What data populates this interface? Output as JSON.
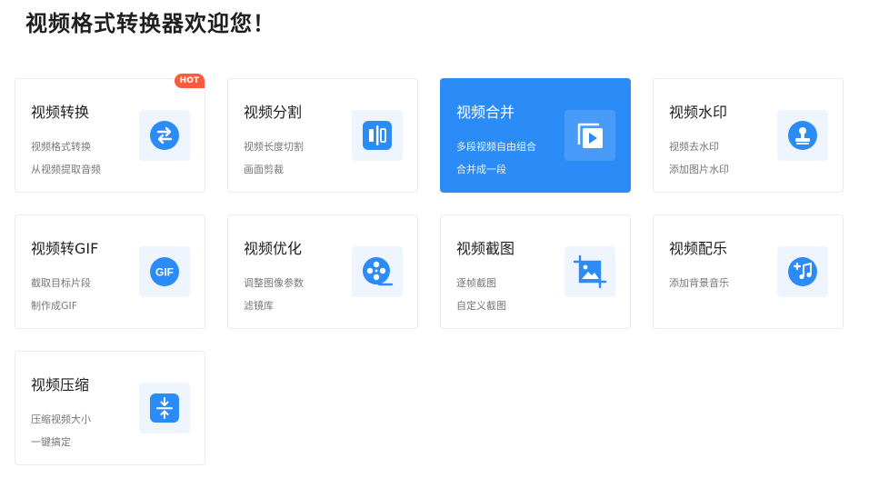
{
  "page": {
    "title": "视频格式转换器欢迎您！"
  },
  "colors": {
    "accent": "#2b8bf7",
    "hot": "#ff5a3c"
  },
  "cards": [
    {
      "title": "视频转换",
      "line1": "视频格式转换",
      "line2": "从视频提取音频",
      "icon": "swap-arrows-icon",
      "badge": "HOT"
    },
    {
      "title": "视频分割",
      "line1": "视频长度切割",
      "line2": "画面剪裁",
      "icon": "split-icon"
    },
    {
      "title": "视频合并",
      "line1": "多段视频自由组合",
      "line2": "合并成一段",
      "icon": "merge-play-icon",
      "active": true
    },
    {
      "title": "视频水印",
      "line1": "视频去水印",
      "line2": "添加图片水印",
      "icon": "stamp-icon"
    },
    {
      "title": "视频转GIF",
      "line1": "截取目标片段",
      "line2": "制作成GIF",
      "icon": "gif-icon",
      "icon_text": "GIF"
    },
    {
      "title": "视频优化",
      "line1": "调整图像参数",
      "line2": "滤镜库",
      "icon": "film-reel-icon"
    },
    {
      "title": "视频截图",
      "line1": "逐帧截图",
      "line2": "自定义截图",
      "icon": "crop-image-icon"
    },
    {
      "title": "视频配乐",
      "line1": "添加背景音乐",
      "line2": "",
      "icon": "add-music-icon"
    },
    {
      "title": "视频压缩",
      "line1": "压缩视频大小",
      "line2": "一键搞定",
      "icon": "compress-icon"
    }
  ]
}
